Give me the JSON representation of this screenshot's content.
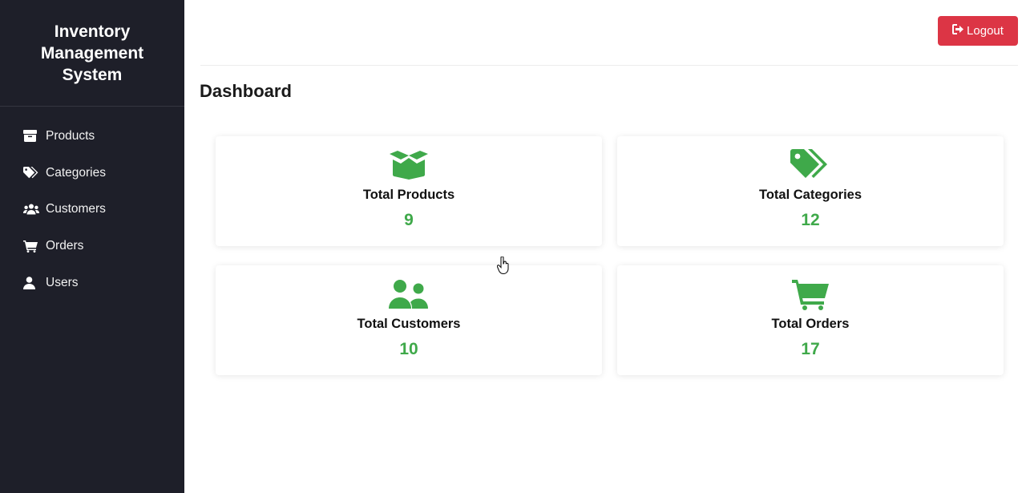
{
  "sidebar": {
    "brand": "Inventory Management System",
    "items": [
      {
        "label": "Products",
        "icon": "box-icon"
      },
      {
        "label": "Categories",
        "icon": "tags-icon"
      },
      {
        "label": "Customers",
        "icon": "users-icon"
      },
      {
        "label": "Orders",
        "icon": "cart-icon"
      },
      {
        "label": "Users",
        "icon": "user-icon"
      }
    ]
  },
  "header": {
    "logout_label": "Logout"
  },
  "main": {
    "title": "Dashboard",
    "cards": [
      {
        "label": "Total Products",
        "value": "9",
        "icon": "box-open-icon"
      },
      {
        "label": "Total Categories",
        "value": "12",
        "icon": "tags-icon"
      },
      {
        "label": "Total Customers",
        "value": "10",
        "icon": "user-group-icon"
      },
      {
        "label": "Total Orders",
        "value": "17",
        "icon": "cart-icon"
      }
    ]
  },
  "colors": {
    "sidebar_bg": "#1e1f29",
    "accent_green": "#3fa94a",
    "logout_red": "#dc3545"
  }
}
